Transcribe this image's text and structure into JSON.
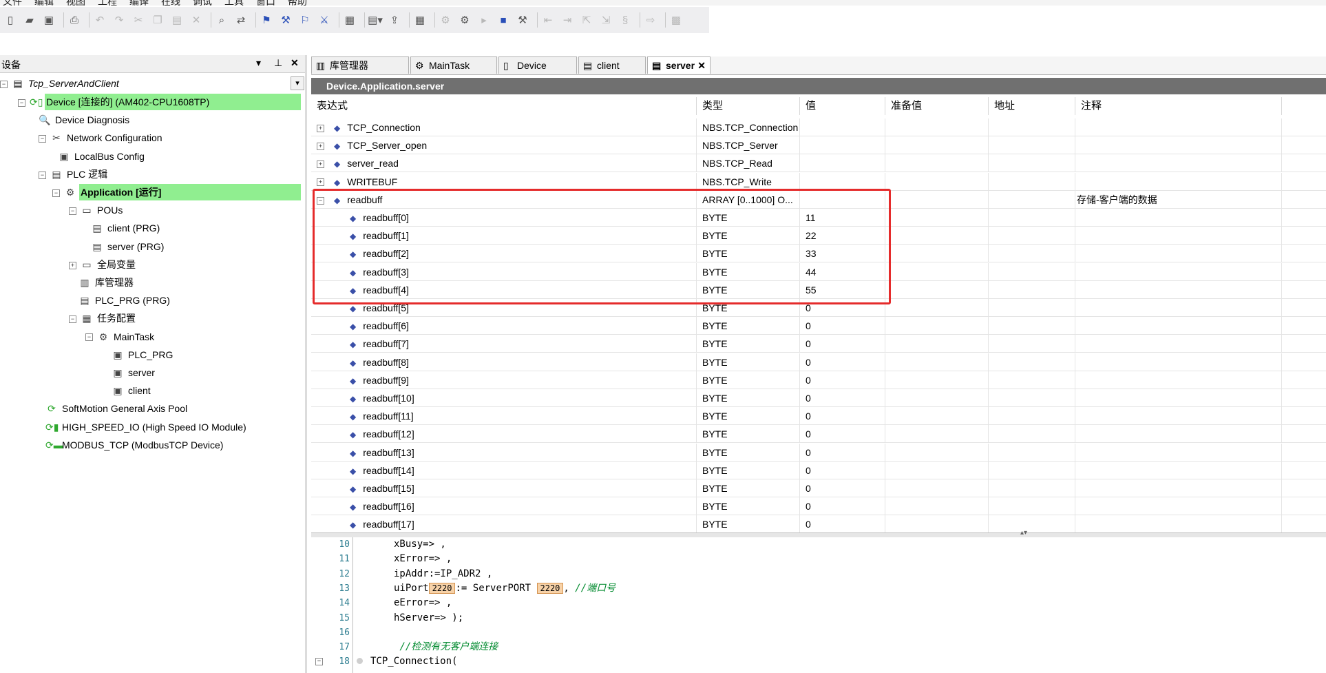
{
  "menubar": [
    "文件",
    "编辑",
    "视图",
    "工程",
    "编译",
    "在线",
    "调试",
    "工具",
    "窗口",
    "帮助"
  ],
  "device_pane": {
    "title": "设备",
    "root": "Tcp_ServerAndClient",
    "nodes": [
      {
        "label": "Device [连接的] (AM402-CPU1608TP)",
        "icon": "device-icon"
      },
      {
        "label": "Device Diagnosis",
        "icon": "diagnosis-icon"
      },
      {
        "label": "Network Configuration",
        "icon": "network-config-icon"
      },
      {
        "label": "LocalBus Config",
        "icon": "localbus-icon"
      },
      {
        "label": "PLC 逻辑",
        "icon": "plc-logic-icon"
      },
      {
        "label": "Application [运行]",
        "icon": "application-icon"
      },
      {
        "label": "POUs",
        "icon": "folder-icon"
      },
      {
        "label": "client (PRG)",
        "icon": "program-icon"
      },
      {
        "label": "server (PRG)",
        "icon": "program-icon"
      },
      {
        "label": "全局变量",
        "icon": "folder-icon"
      },
      {
        "label": "库管理器",
        "icon": "library-icon"
      },
      {
        "label": "PLC_PRG (PRG)",
        "icon": "program-icon"
      },
      {
        "label": "任务配置",
        "icon": "task-config-icon"
      },
      {
        "label": "MainTask",
        "icon": "task-icon"
      },
      {
        "label": "PLC_PRG",
        "icon": "task-call-icon"
      },
      {
        "label": "server",
        "icon": "task-call-icon"
      },
      {
        "label": "client",
        "icon": "task-call-icon"
      },
      {
        "label": "SoftMotion General Axis Pool",
        "icon": "axis-pool-icon"
      },
      {
        "label": "HIGH_SPEED_IO (High Speed IO Module)",
        "icon": "io-module-icon"
      },
      {
        "label": "MODBUS_TCP (ModbusTCP Device)",
        "icon": "modbus-icon"
      }
    ]
  },
  "tabs": [
    {
      "label": "库管理器",
      "icon": "library-icon"
    },
    {
      "label": "MainTask",
      "icon": "task-icon"
    },
    {
      "label": "Device",
      "icon": "device-icon"
    },
    {
      "label": "client",
      "icon": "program-icon"
    },
    {
      "label": "server",
      "icon": "program-icon",
      "active": true
    }
  ],
  "path": "Device.Application.server",
  "table": {
    "headers": [
      "表达式",
      "类型",
      "值",
      "准备值",
      "地址",
      "注释"
    ],
    "rows": [
      {
        "expr": "TCP_Connection",
        "type": "NBS.TCP_Connection",
        "value": "",
        "comment": "",
        "expander": "+"
      },
      {
        "expr": "TCP_Server_open",
        "type": "NBS.TCP_Server",
        "value": "",
        "comment": "",
        "expander": "+"
      },
      {
        "expr": "server_read",
        "type": "NBS.TCP_Read",
        "value": "",
        "comment": "",
        "expander": "+"
      },
      {
        "expr": "WRITEBUF",
        "type": "NBS.TCP_Write",
        "value": "",
        "comment": "",
        "expander": "+"
      },
      {
        "expr": "readbuff",
        "type": "ARRAY [0..1000] O...",
        "value": "",
        "comment": "存储-客户端的数据",
        "expander": "−"
      },
      {
        "expr": "readbuff[0]",
        "type": "BYTE",
        "value": "11",
        "comment": ""
      },
      {
        "expr": "readbuff[1]",
        "type": "BYTE",
        "value": "22",
        "comment": ""
      },
      {
        "expr": "readbuff[2]",
        "type": "BYTE",
        "value": "33",
        "comment": ""
      },
      {
        "expr": "readbuff[3]",
        "type": "BYTE",
        "value": "44",
        "comment": ""
      },
      {
        "expr": "readbuff[4]",
        "type": "BYTE",
        "value": "55",
        "comment": ""
      },
      {
        "expr": "readbuff[5]",
        "type": "BYTE",
        "value": "0",
        "comment": ""
      },
      {
        "expr": "readbuff[6]",
        "type": "BYTE",
        "value": "0",
        "comment": ""
      },
      {
        "expr": "readbuff[7]",
        "type": "BYTE",
        "value": "0",
        "comment": ""
      },
      {
        "expr": "readbuff[8]",
        "type": "BYTE",
        "value": "0",
        "comment": ""
      },
      {
        "expr": "readbuff[9]",
        "type": "BYTE",
        "value": "0",
        "comment": ""
      },
      {
        "expr": "readbuff[10]",
        "type": "BYTE",
        "value": "0",
        "comment": ""
      },
      {
        "expr": "readbuff[11]",
        "type": "BYTE",
        "value": "0",
        "comment": ""
      },
      {
        "expr": "readbuff[12]",
        "type": "BYTE",
        "value": "0",
        "comment": ""
      },
      {
        "expr": "readbuff[13]",
        "type": "BYTE",
        "value": "0",
        "comment": ""
      },
      {
        "expr": "readbuff[14]",
        "type": "BYTE",
        "value": "0",
        "comment": ""
      },
      {
        "expr": "readbuff[15]",
        "type": "BYTE",
        "value": "0",
        "comment": ""
      },
      {
        "expr": "readbuff[16]",
        "type": "BYTE",
        "value": "0",
        "comment": ""
      },
      {
        "expr": "readbuff[17]",
        "type": "BYTE",
        "value": "0",
        "comment": ""
      }
    ]
  },
  "code": [
    {
      "n": "10",
      "t": "xBusy=> ,"
    },
    {
      "n": "11",
      "t": "xError=> ,"
    },
    {
      "n": "12",
      "t": "ipAddr:=IP_ADR2 ,"
    },
    {
      "n": "13",
      "t": "uiPort",
      "box1": "2220",
      "t2": ":= ServerPORT",
      "box2": "2220",
      "t3": ",",
      "cmt": "//端口号"
    },
    {
      "n": "14",
      "t": "eError=> ,"
    },
    {
      "n": "15",
      "t": "hServer=> );"
    },
    {
      "n": "16",
      "t": ""
    },
    {
      "n": "17",
      "cmt": "//检测有无客户端连接"
    },
    {
      "n": "18",
      "t": "TCP_Connection("
    }
  ],
  "colors": {
    "highlight": "#90ee90",
    "redbox": "#e52b2b",
    "pathbar": "#707070"
  }
}
